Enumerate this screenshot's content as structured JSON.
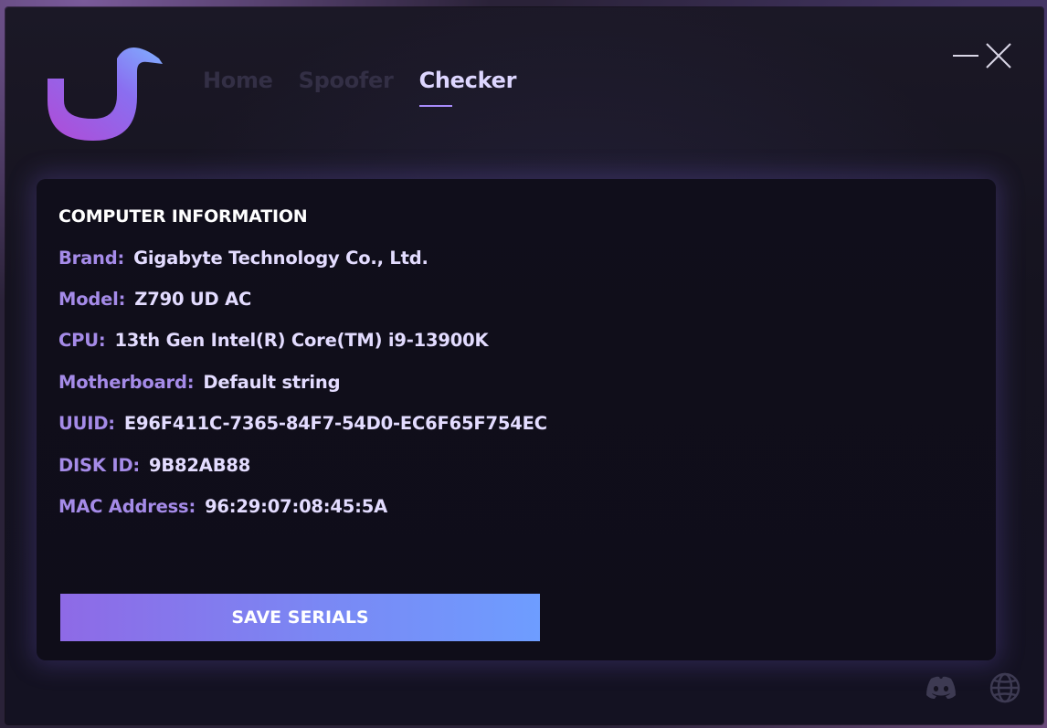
{
  "nav": {
    "tabs": [
      {
        "label": "Home"
      },
      {
        "label": "Spoofer"
      },
      {
        "label": "Checker"
      }
    ]
  },
  "window_controls": {
    "minimize_icon": "minimize-icon",
    "close_icon": "close-icon"
  },
  "info": {
    "title": "COMPUTER INFORMATION",
    "rows": [
      {
        "label": "Brand:",
        "value": "Gigabyte Technology Co., Ltd."
      },
      {
        "label": "Model:",
        "value": "Z790 UD AC"
      },
      {
        "label": "CPU:",
        "value": "13th Gen Intel(R) Core(TM) i9-13900K"
      },
      {
        "label": "Motherboard:",
        "value": "Default string"
      },
      {
        "label": "UUID:",
        "value": "E96F411C-7365-84F7-54D0-EC6F65F754EC"
      },
      {
        "label": "DISK ID:",
        "value": "9B82AB88"
      },
      {
        "label": "MAC Address:",
        "value": "96:29:07:08:45:5A"
      }
    ]
  },
  "actions": {
    "save_label": "SAVE SERIALS"
  },
  "footer": {
    "icons": [
      "discord-icon",
      "globe-icon"
    ]
  },
  "colors": {
    "accent": "#a58be8",
    "button_start": "#8e6ae6",
    "button_end": "#6e9dff",
    "card_bg": "#100e1b"
  }
}
